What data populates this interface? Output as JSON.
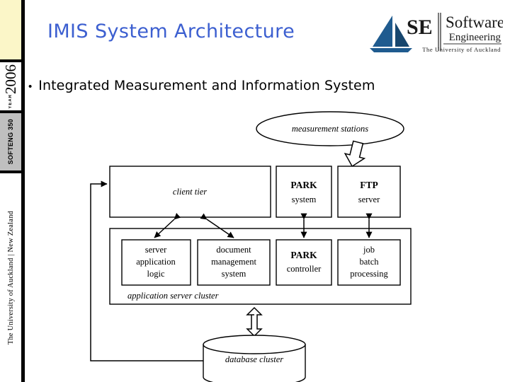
{
  "sidebar": {
    "year_number": "2006",
    "year_label": "YEAR",
    "course_code": "SOFTENG 350",
    "university": "The University of Auckland | New Zealand"
  },
  "header": {
    "title": "IMIS System Architecture",
    "bullet_marker": "•",
    "bullet_text": "Integrated Measurement and Information System",
    "title_color": "#3c5fd0"
  },
  "logo": {
    "mark_name": "se-sailboat-logo",
    "initials": "SE",
    "line1": "Software",
    "line2": "Engineering",
    "line3": "The University of Auckland",
    "sail_color": "#1f5b8f",
    "sail_color_dark": "#17466e"
  },
  "diagram": {
    "type": "system-architecture",
    "external_source": "measurement stations",
    "tier1": {
      "client": "client tier",
      "park_line1": "PARK",
      "park_line2": "system",
      "ftp_line1": "FTP",
      "ftp_line2": "server"
    },
    "tier2": {
      "cluster_label": "application server cluster",
      "nodes": [
        {
          "line1": "server",
          "line2": "application",
          "line3": "logic",
          "bold_first": false
        },
        {
          "line1": "document",
          "line2": "management",
          "line3": "system",
          "bold_first": false
        },
        {
          "line1": "PARK",
          "line2": "controller",
          "line3": "",
          "bold_first": true
        },
        {
          "line1": "job",
          "line2": "batch",
          "line3": "processing",
          "bold_first": false
        }
      ]
    },
    "tier3": {
      "database": "database cluster"
    },
    "connector_names": [
      "measurement-stations-to-client-block-arrow",
      "client-to-server-application-logic",
      "client-to-document-management-system",
      "park-system-to-park-controller",
      "ftp-server-to-job-batch-processing",
      "application-cluster-to-database-block-arrow",
      "database-to-client-feedback-line"
    ]
  }
}
